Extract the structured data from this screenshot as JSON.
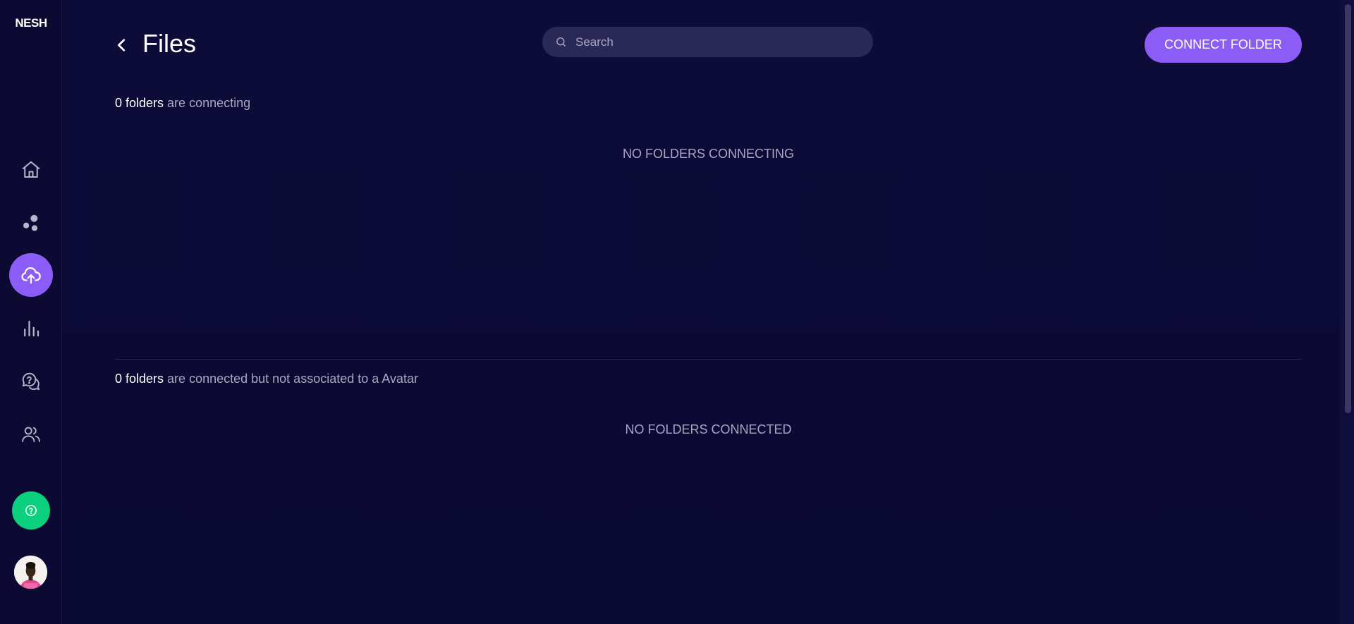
{
  "app": {
    "logo": "NESH"
  },
  "sidebar": {
    "items": [
      {
        "name": "home",
        "icon": "home-icon"
      },
      {
        "name": "avatars",
        "icon": "bubbles-icon"
      },
      {
        "name": "files",
        "icon": "cloud-upload-icon",
        "active": true
      },
      {
        "name": "analytics",
        "icon": "bar-chart-icon"
      },
      {
        "name": "support",
        "icon": "question-chat-icon"
      },
      {
        "name": "users",
        "icon": "users-icon"
      }
    ],
    "help_icon": "question-circle-icon",
    "help_color": "#0bd17f"
  },
  "header": {
    "title": "Files",
    "back_icon": "chevron-left-icon"
  },
  "search": {
    "placeholder": "Search",
    "value": ""
  },
  "toolbar": {
    "connect_label": "CONNECT FOLDER"
  },
  "connecting": {
    "count_label": "0 folders",
    "suffix": " are connecting",
    "empty_message": "NO FOLDERS CONNECTING"
  },
  "connected": {
    "count_label": "0 folders",
    "suffix": " are connected but not associated to a Avatar",
    "empty_message": "NO FOLDERS CONNECTED"
  },
  "colors": {
    "accent": "#8b5cf6",
    "background": "#0c0a35",
    "muted_text": "#a8a6c0"
  }
}
